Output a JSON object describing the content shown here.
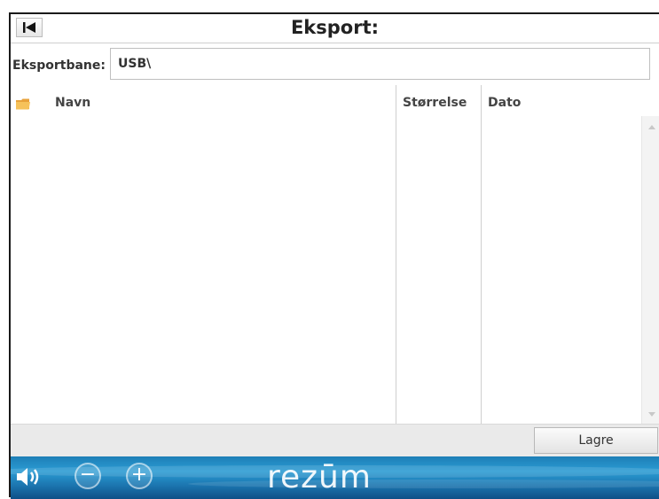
{
  "header": {
    "title": "Eksport:",
    "back_icon": "skip-back-icon"
  },
  "export_path": {
    "label": "Eksportbane:",
    "value": "USB\\"
  },
  "table": {
    "columns": [
      {
        "label": "Navn",
        "icon": "folder-icon"
      },
      {
        "label": "Størrelse"
      },
      {
        "label": "Dato"
      }
    ],
    "rows": []
  },
  "toolbar": {
    "save_label": "Lagre"
  },
  "bottom_bar": {
    "volume_icon": "speaker-icon",
    "minus_label": "−",
    "plus_label": "+",
    "brand": "rezūm",
    "colors": {
      "primary": "#1e7fb7",
      "dark": "#0e4f86"
    }
  }
}
